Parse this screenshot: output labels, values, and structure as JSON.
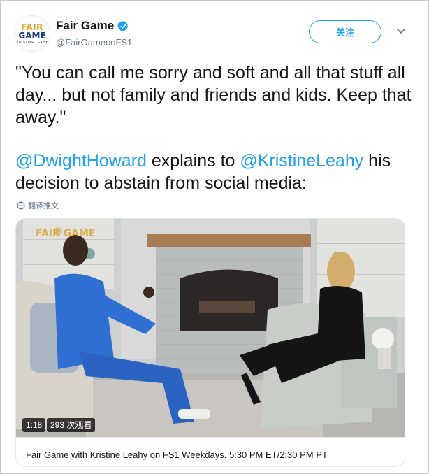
{
  "account": {
    "display_name": "Fair Game",
    "handle": "@FairGameonFS1",
    "avatar_text": {
      "line1": "FAIR",
      "line2": "GAME",
      "line3": "KRISTINE LEAHY"
    }
  },
  "header": {
    "follow_label": "关注"
  },
  "tweet": {
    "quote": "\"You can call me sorry and soft and all that stuff all day... but not family and friends and kids. Keep that away.\"",
    "mention_1": "@DwightHoward",
    "text_mid": " explains to ",
    "mention_2": "@KristineLeahy",
    "text_end": " his decision to abstain from social media:",
    "translate_label": "翻译推文"
  },
  "media": {
    "watermark": "FAIR GAME",
    "duration": "1:18",
    "views": "293 次观看",
    "caption": "Fair Game with Kristine Leahy on FS1 Weekdays. 5:30 PM ET/2:30 PM PT"
  },
  "colors": {
    "link": "#1da1f2",
    "text": "#14171a",
    "muted": "#657786",
    "border": "#e1e8ed"
  }
}
